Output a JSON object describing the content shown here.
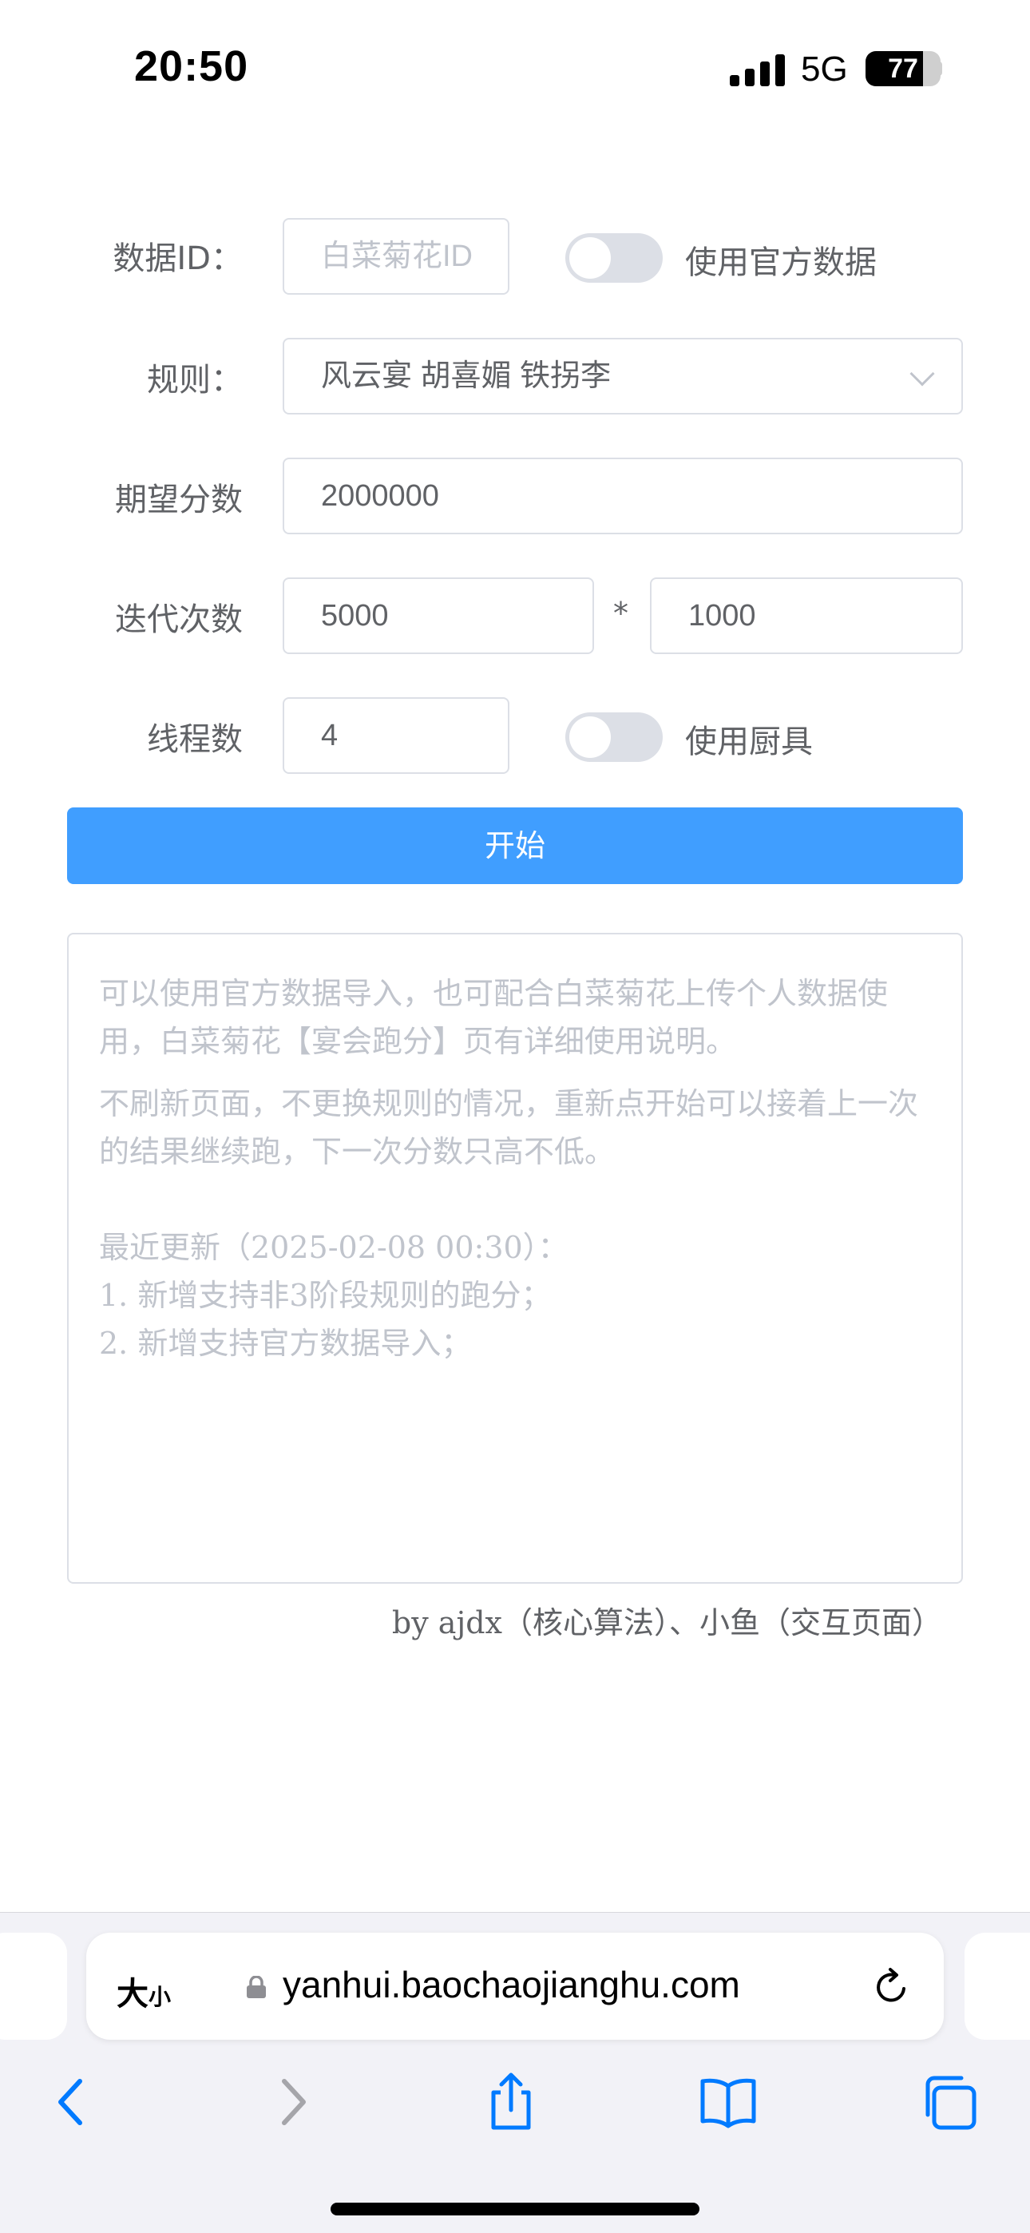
{
  "status_bar": {
    "time": "20:50",
    "network": "5G",
    "battery": "77",
    "battery_level": 0.77
  },
  "form": {
    "data_id": {
      "label": "数据ID：",
      "placeholder": "白菜菊花ID"
    },
    "official_data": {
      "label": "使用官方数据",
      "on": false
    },
    "rule": {
      "label": "规则：",
      "value": "风云宴 胡喜媚 铁拐李"
    },
    "expected_score": {
      "label": "期望分数",
      "value": "2000000"
    },
    "iterations": {
      "label": "迭代次数",
      "value1": "5000",
      "multiplier": "*",
      "value2": "1000"
    },
    "threads": {
      "label": "线程数",
      "value": "4"
    },
    "use_tools": {
      "label": "使用厨具",
      "on": false
    },
    "start_label": "开始"
  },
  "notes": {
    "line1": "可以使用官方数据导入，也可配合白菜菊花上传个人数据使用，白菜菊花【宴会跑分】页有详细使用说明。",
    "line2": "不刷新页面，不更换规则的情况，重新点开始可以接着上一次的结果继续跑，下一次分数只高不低。",
    "update_title": "最近更新（2025-02-08 00:30）：",
    "update_1": "1. 新增支持非3阶段规则的跑分；",
    "update_2": "2. 新增支持官方数据导入；"
  },
  "credit": "by ajdx（核心算法）、小鱼（交互页面）",
  "browser": {
    "text_size_label": "大",
    "text_size_small": "小",
    "url": "yanhui.baochaojianghu.com"
  },
  "colors": {
    "primary": "#409eff",
    "border": "#dcdfe6",
    "placeholder": "#c0c4cc",
    "text": "#606266",
    "switch_off": "#dcdfe6",
    "ios_blue": "#007aff"
  },
  "icons": [
    "lock-icon",
    "reload-icon",
    "back-icon",
    "forward-icon",
    "share-icon",
    "bookmarks-icon",
    "tabs-icon",
    "chevron-down-icon"
  ]
}
